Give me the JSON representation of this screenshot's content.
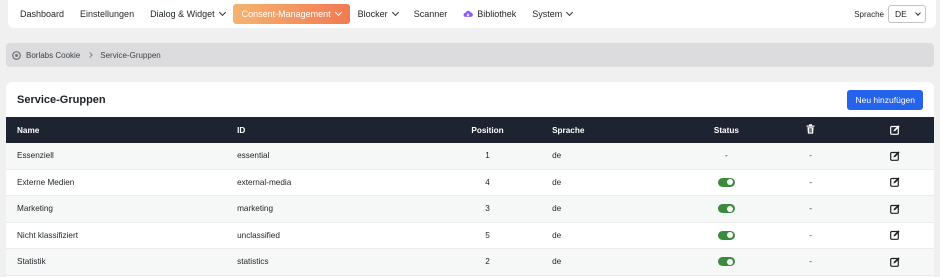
{
  "nav": {
    "items": [
      {
        "label": "Dashboard",
        "chevron": false,
        "active": false
      },
      {
        "label": "Einstellungen",
        "chevron": false,
        "active": false
      },
      {
        "label": "Dialog & Widget",
        "chevron": true,
        "active": false
      },
      {
        "label": "Consent-Management",
        "chevron": true,
        "active": true
      },
      {
        "label": "Blocker",
        "chevron": true,
        "active": false
      },
      {
        "label": "Scanner",
        "chevron": false,
        "active": false
      },
      {
        "label": "Bibliothek",
        "chevron": false,
        "active": false,
        "icon": "cloud-download-icon"
      },
      {
        "label": "System",
        "chevron": true,
        "active": false
      }
    ],
    "language_label": "Sprache",
    "language_value": "DE"
  },
  "breadcrumb": {
    "root": "Borlabs Cookie",
    "current": "Service-Gruppen"
  },
  "card": {
    "title": "Service-Gruppen",
    "add_button": "Neu hinzufügen"
  },
  "table": {
    "headers": {
      "name": "Name",
      "id": "ID",
      "position": "Position",
      "language": "Sprache",
      "status": "Status"
    },
    "rows": [
      {
        "name": "Essenziell",
        "id": "essential",
        "position": "1",
        "language": "de",
        "status": "-",
        "delete": "-"
      },
      {
        "name": "Externe Medien",
        "id": "external-media",
        "position": "4",
        "language": "de",
        "status": "on",
        "delete": "-"
      },
      {
        "name": "Marketing",
        "id": "marketing",
        "position": "3",
        "language": "de",
        "status": "on",
        "delete": "-"
      },
      {
        "name": "Nicht klassifiziert",
        "id": "unclassified",
        "position": "5",
        "language": "de",
        "status": "on",
        "delete": "-"
      },
      {
        "name": "Statistik",
        "id": "statistics",
        "position": "2",
        "language": "de",
        "status": "on",
        "delete": "-"
      }
    ]
  },
  "colors": {
    "accent_gradient_start": "#f6b36f",
    "accent_gradient_end": "#f27a52",
    "primary_button": "#2563eb",
    "table_header": "#1d2330",
    "toggle_on": "#3b8a3e"
  }
}
